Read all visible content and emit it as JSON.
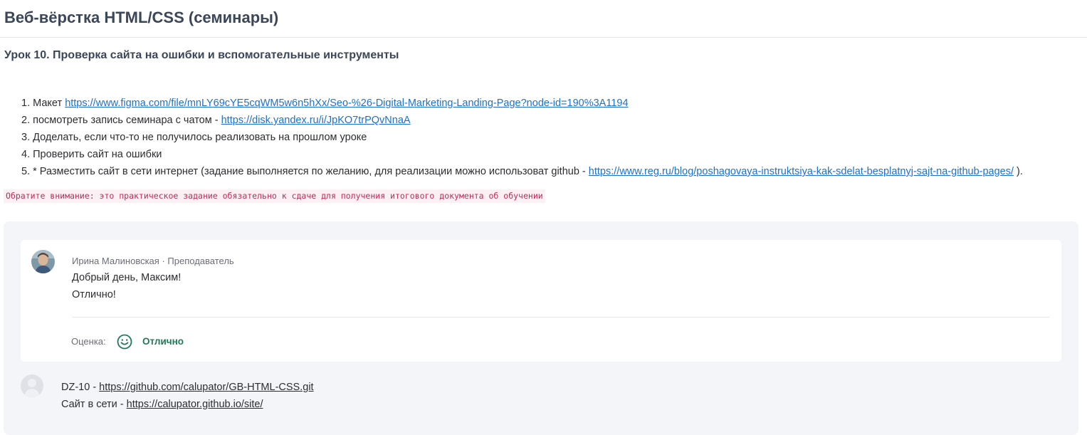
{
  "course": {
    "title": "Веб-вёрстка HTML/CSS (семинары)"
  },
  "lesson": {
    "title": "Урок 10. Проверка сайта на ошибки и вспомогательные инструменты",
    "tasks": [
      {
        "prefix": "1. Макет ",
        "link": "https://www.figma.com/file/mnLY69cYE5cqWM5w6n5hXx/Seo-%26-Digital-Marketing-Landing-Page?node-id=190%3A1194",
        "suffix": ""
      },
      {
        "prefix": "2. посмотреть запись семинара с чатом - ",
        "link": "https://disk.yandex.ru/i/JpKO7trPQvNnaA",
        "suffix": ""
      },
      {
        "prefix": "3. Доделать, если что-то не получилось реализовать на прошлом уроке",
        "link": "",
        "suffix": ""
      },
      {
        "prefix": "4. Проверить сайт на ошибки",
        "link": "",
        "suffix": ""
      },
      {
        "prefix": "5. * Разместить сайт в сети интернет (задание выполняется по желанию, для реализации можно использоват github - ",
        "link": "https://www.reg.ru/blog/poshagovaya-instruktsiya-kak-sdelat-besplatnyj-sajt-na-github-pages/",
        "suffix": " )."
      }
    ],
    "notice": "Обратите внимание: это практическое задание обязательно к сдаче для получения итогового документа об обучении"
  },
  "comment": {
    "author": "Ирина Малиновская",
    "separator": "·",
    "role": "Преподаватель",
    "lines": [
      "Добрый день, Максим!",
      "Отлично!"
    ],
    "grade_label": "Оценка:",
    "grade_value": "Отлично",
    "grade_icon": "smiley-icon",
    "accent_color": "#1f7a57"
  },
  "submission": {
    "line1_prefix": "DZ-10 - ",
    "line1_link": "https://github.com/calupator/GB-HTML-CSS.git",
    "line2_prefix": "Сайт в сети - ",
    "line2_link": "https://calupator.github.io/site/"
  }
}
